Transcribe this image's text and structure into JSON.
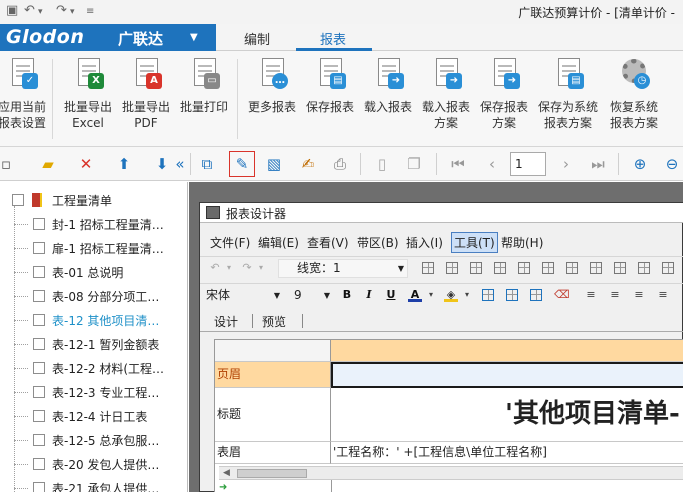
{
  "window": {
    "title": "广联达预算计价 - [清单计价 -"
  },
  "brand": {
    "name": "Glodon",
    "name_cn": "广联达"
  },
  "tabs": [
    {
      "label": "编制"
    },
    {
      "label": "报表"
    }
  ],
  "ribbon": {
    "buttons": [
      {
        "line1": "应用当前",
        "line2": "报表设置"
      },
      {
        "line1": "批量导出",
        "line2": "Excel"
      },
      {
        "line1": "批量导出",
        "line2": "PDF"
      },
      {
        "line1": "批量打印",
        "line2": ""
      },
      {
        "line1": "更多报表",
        "line2": ""
      },
      {
        "line1": "保存报表",
        "line2": ""
      },
      {
        "line1": "载入报表",
        "line2": ""
      },
      {
        "line1": "载入报表",
        "line2": "方案"
      },
      {
        "line1": "保存报表",
        "line2": "方案"
      },
      {
        "line1": "保存为系统",
        "line2": "报表方案"
      },
      {
        "line1": "恢复系统",
        "line2": "报表方案"
      }
    ]
  },
  "toolbar2": {
    "page_number": "1"
  },
  "tree": {
    "root": "工程量清单",
    "items": [
      "封-1 招标工程量清…",
      "扉-1 招标工程量清…",
      "表-01 总说明",
      "表-08 分部分项工…",
      "表-12 其他项目清…",
      "表-12-1 暂列金额表",
      "表-12-2 材料(工程…",
      "表-12-3 专业工程…",
      "表-12-4 计日工表",
      "表-12-5 总承包服…",
      "表-20 发包人提供…",
      "表-21 承包人提供…"
    ]
  },
  "designer": {
    "title": "报表设计器",
    "menu": [
      "文件(F)",
      "编辑(E)",
      "查看(V)",
      "带区(B)",
      "插入(I)",
      "工具(T)",
      "帮助(H)"
    ],
    "line_width_label": "线宽：1",
    "font_name": "宋体",
    "font_size": "9",
    "tabs": [
      "设计",
      "预览"
    ],
    "rows": [
      {
        "label": "",
        "content": ""
      },
      {
        "label": "页眉",
        "content": ""
      },
      {
        "label": "标题",
        "content": "'其他项目清单-"
      },
      {
        "label": "表眉",
        "content": "'工程名称：' +[工程信息\\单位工程名称]"
      }
    ]
  },
  "colors": {
    "brand_blue": "#1e73bd",
    "selected_row_orange": "#ffd9a0",
    "active_tree_text": "#1e90c8"
  }
}
